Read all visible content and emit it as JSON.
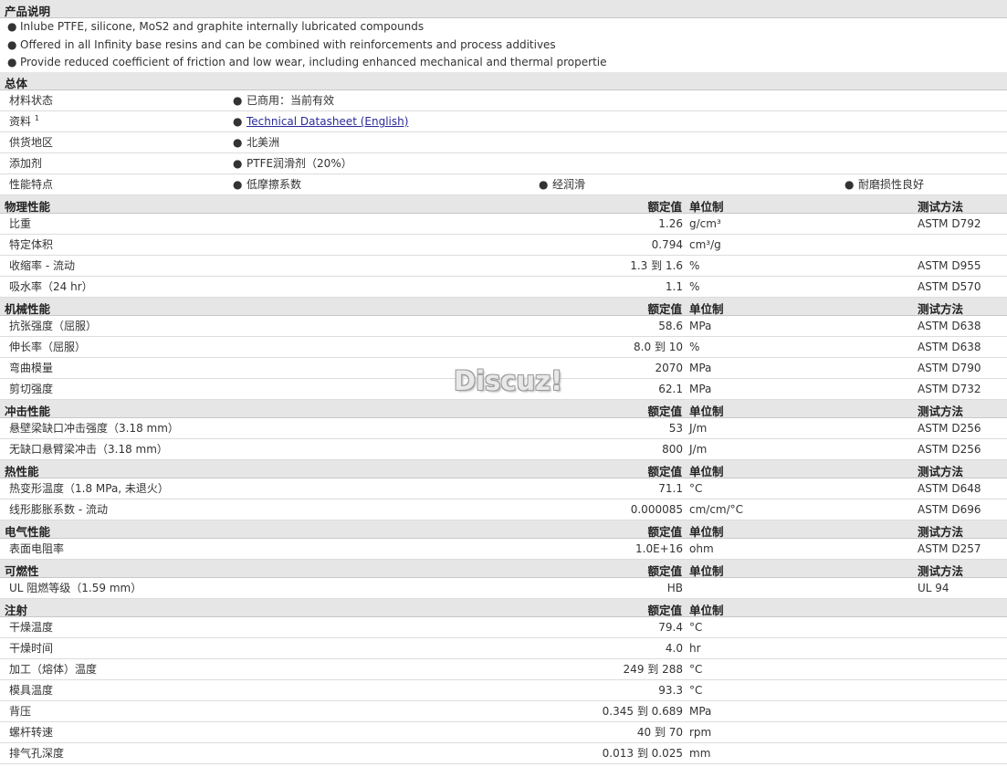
{
  "description_section": {
    "title": "产品说明",
    "bullets": [
      "Inlube PTFE, silicone, MoS2 and graphite internally lubricated compounds",
      "Offered in all Infinity base resins and can be combined with reinforcements and process additives",
      "Provide reduced coefficient of friction and low wear, including enhanced mechanical and thermal propertie"
    ]
  },
  "general_section": {
    "title": "总体",
    "rows": [
      {
        "label": "材料状态",
        "items": [
          "已商用：当前有效"
        ]
      },
      {
        "label": "资料",
        "sup": "1",
        "link": "Technical Datasheet (English)"
      },
      {
        "label": "供货地区",
        "items": [
          "北美洲"
        ]
      },
      {
        "label": "添加剂",
        "items": [
          "PTFE润滑剂（20%）"
        ]
      },
      {
        "label": "性能特点",
        "items": [
          "低摩擦系数",
          "经润滑",
          "耐磨损性良好"
        ]
      }
    ]
  },
  "column_headers": {
    "value": "额定值",
    "unit": "单位制",
    "test": "测试方法"
  },
  "property_sections": [
    {
      "title": "物理性能",
      "show_test": true,
      "rows": [
        {
          "label": "比重",
          "value": "1.26",
          "unit": "g/cm³",
          "test": "ASTM D792"
        },
        {
          "label": "特定体积",
          "value": "0.794",
          "unit": "cm³/g",
          "test": ""
        },
        {
          "label": "收缩率  - 流动",
          "value": "1.3 到  1.6",
          "unit": "%",
          "test": "ASTM D955"
        },
        {
          "label": "吸水率（24 hr）",
          "value": "1.1",
          "unit": "%",
          "test": "ASTM D570"
        }
      ]
    },
    {
      "title": "机械性能",
      "show_test": true,
      "rows": [
        {
          "label": "抗张强度（屈服）",
          "value": "58.6",
          "unit": "MPa",
          "test": "ASTM D638"
        },
        {
          "label": "伸长率（屈服）",
          "value": "8.0 到  10",
          "unit": "%",
          "test": "ASTM D638"
        },
        {
          "label": "弯曲模量",
          "value": "2070",
          "unit": "MPa",
          "test": "ASTM D790"
        },
        {
          "label": "剪切强度",
          "value": "62.1",
          "unit": "MPa",
          "test": "ASTM D732"
        }
      ]
    },
    {
      "title": "冲击性能",
      "show_test": true,
      "rows": [
        {
          "label": "悬壁梁缺口冲击强度（3.18 mm）",
          "value": "53",
          "unit": "J/m",
          "test": "ASTM D256"
        },
        {
          "label": "无缺口悬臂梁冲击（3.18 mm）",
          "value": "800",
          "unit": "J/m",
          "test": "ASTM D256"
        }
      ]
    },
    {
      "title": "热性能",
      "show_test": true,
      "rows": [
        {
          "label": "热变形温度（1.8 MPa, 未退火）",
          "value": "71.1",
          "unit": "°C",
          "test": "ASTM D648"
        },
        {
          "label": "线形膨胀系数  - 流动",
          "value": "0.000085",
          "unit": "cm/cm/°C",
          "test": "ASTM D696"
        }
      ]
    },
    {
      "title": "电气性能",
      "show_test": true,
      "rows": [
        {
          "label": "表面电阻率",
          "value": "1.0E+16",
          "unit": "ohm",
          "test": "ASTM D257"
        }
      ]
    },
    {
      "title": "可燃性",
      "show_test": true,
      "rows": [
        {
          "label": "UL 阻燃等级（1.59 mm）",
          "value": "HB",
          "unit": "",
          "test": "UL 94"
        }
      ]
    },
    {
      "title": "注射",
      "show_test": false,
      "rows": [
        {
          "label": "干燥温度",
          "value": "79.4",
          "unit": "°C",
          "test": ""
        },
        {
          "label": "干燥时间",
          "value": "4.0",
          "unit": "hr",
          "test": ""
        },
        {
          "label": "加工（熔体）温度",
          "value": "249 到  288",
          "unit": "°C",
          "test": ""
        },
        {
          "label": "模具温度",
          "value": "93.3",
          "unit": "°C",
          "test": ""
        },
        {
          "label": "背压",
          "value": "0.345 到  0.689",
          "unit": "MPa",
          "test": ""
        },
        {
          "label": "螺杆转速",
          "value": "40 到  70",
          "unit": "rpm",
          "test": ""
        },
        {
          "label": "排气孔深度",
          "value": "0.013 到  0.025",
          "unit": "mm",
          "test": ""
        }
      ]
    }
  ],
  "watermark": "Discuz!"
}
